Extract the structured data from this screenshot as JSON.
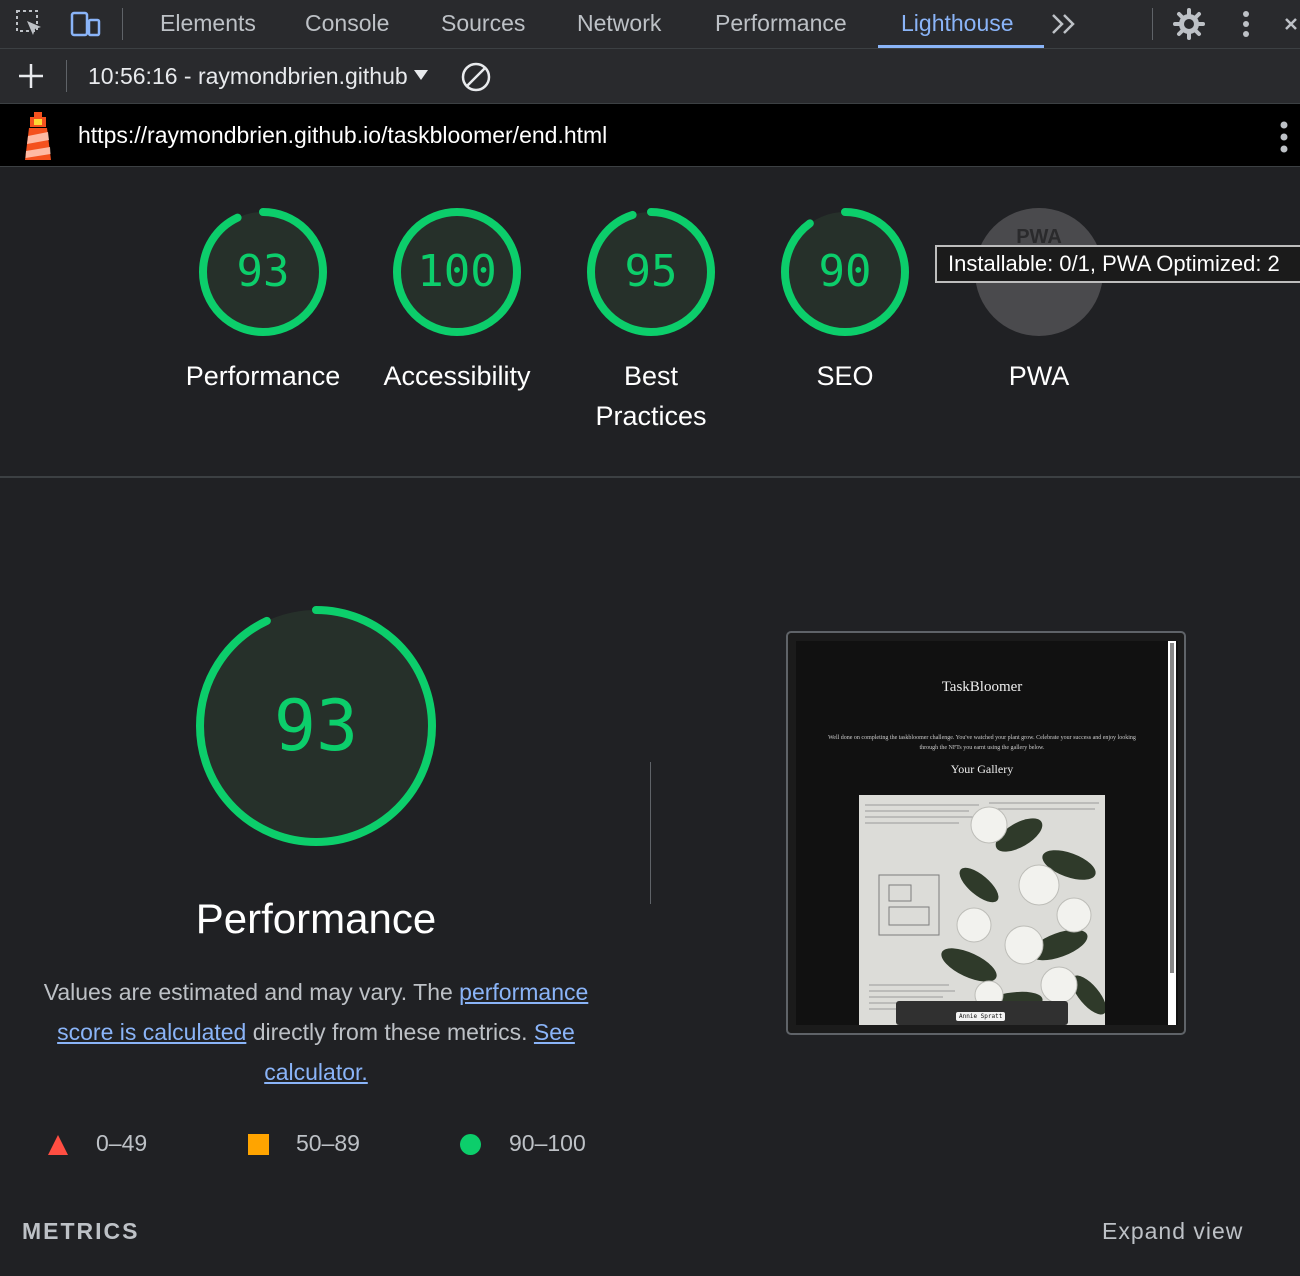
{
  "devtools": {
    "tabs": [
      "Elements",
      "Console",
      "Sources",
      "Network",
      "Performance",
      "Lighthouse"
    ],
    "active_tab": "Lighthouse",
    "icons": [
      "inspect-element-icon",
      "device-toolbar-icon",
      "more-tabs-icon",
      "settings-gear-icon",
      "kebab-menu-icon",
      "close-icon"
    ]
  },
  "toolbar": {
    "report_label": "10:56:16 - raymondbrien.github.io",
    "icons": [
      "add-report-icon",
      "dropdown-caret-icon",
      "clear-icon"
    ]
  },
  "urlbar": {
    "url": "https://raymondbrien.github.io/taskbloomer/end.html",
    "icons": [
      "lighthouse-logo-icon",
      "kebab-menu-icon"
    ]
  },
  "gauges": [
    {
      "score": "93",
      "label": "Performance",
      "fraction": 0.93
    },
    {
      "score": "100",
      "label": "Accessibility",
      "fraction": 1.0
    },
    {
      "score": "95",
      "label_line1": "Best",
      "label_line2": "Practices",
      "fraction": 0.95
    },
    {
      "score": "90",
      "label": "SEO",
      "fraction": 0.9
    },
    {
      "score_text": "PWA",
      "label": "PWA"
    }
  ],
  "tooltip": "Installable: 0/1, PWA Optimized: 2",
  "performance": {
    "score": "93",
    "fraction": 0.93,
    "title": "Performance",
    "desc_1": "Values are estimated and may vary. The ",
    "link_1": "performance score is calculated",
    "desc_2": " directly from these metrics. ",
    "link_2": "See calculator."
  },
  "legend": [
    {
      "range": "0–49",
      "color": "#ff4e42",
      "icon": "triangle-icon"
    },
    {
      "range": "50–89",
      "color": "#ffa400",
      "icon": "square-icon"
    },
    {
      "range": "90–100",
      "color": "#0cce6b",
      "icon": "circle-icon"
    }
  ],
  "metrics_heading": "METRICS",
  "expand_view": "Expand view",
  "screenshot": {
    "title": "TaskBloomer",
    "text": "Well done on completing the taskbloomer challenge. You've watched your plant grow. Celebrate your success and enjoy looking through the NFTs you earnt using the gallery below.",
    "gallery_heading": "Your Gallery",
    "credit": "Annie Spratt"
  },
  "colors": {
    "pass": "#0cce6b",
    "average": "#ffa400",
    "fail": "#ff4e42",
    "link": "#8ab4f8",
    "background": "#202124"
  }
}
